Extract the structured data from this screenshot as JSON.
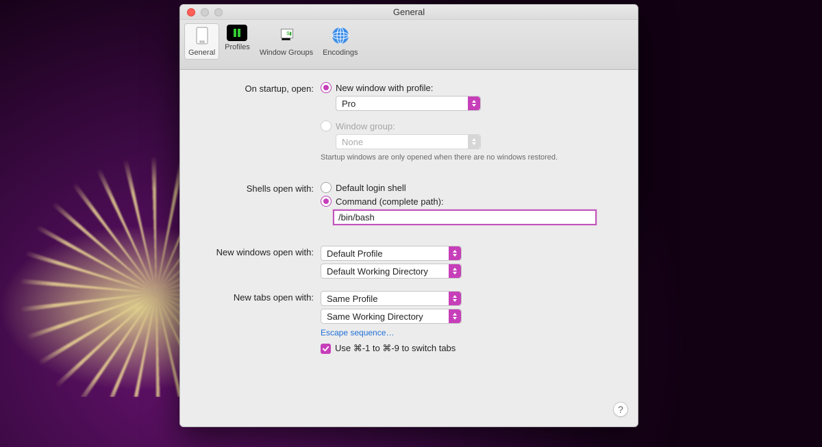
{
  "window": {
    "title": "General"
  },
  "toolbar": {
    "general": "General",
    "profiles": "Profiles",
    "window_groups": "Window Groups",
    "encodings": "Encodings"
  },
  "startup": {
    "label": "On startup, open:",
    "opt_profile": "New window with profile:",
    "profile_value": "Pro",
    "opt_group": "Window group:",
    "group_value": "None",
    "hint": "Startup windows are only opened when there are no windows restored."
  },
  "shells": {
    "label": "Shells open with:",
    "opt_default": "Default login shell",
    "opt_command": "Command (complete path):",
    "command_value": "/bin/bash"
  },
  "new_windows": {
    "label": "New windows open with:",
    "profile": "Default Profile",
    "dir": "Default Working Directory"
  },
  "new_tabs": {
    "label": "New tabs open with:",
    "profile": "Same Profile",
    "dir": "Same Working Directory"
  },
  "escape_link": "Escape sequence…",
  "switch_tabs": "Use ⌘-1 to ⌘-9 to switch tabs",
  "help": "?"
}
